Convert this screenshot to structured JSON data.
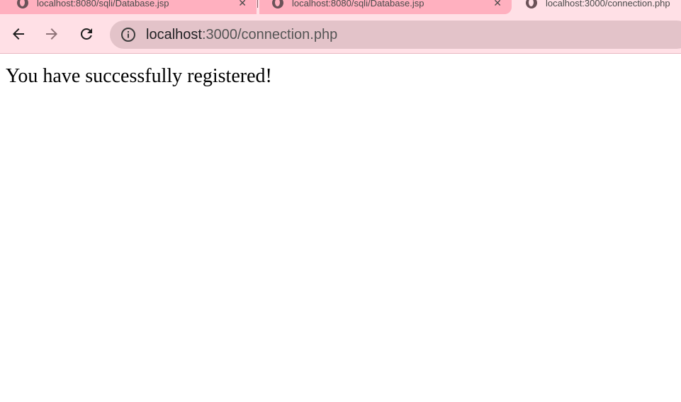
{
  "browser": {
    "tabs": [
      {
        "title": "localhost:8080/sqli/Database.jsp",
        "active": false,
        "close_glyph": "✕"
      },
      {
        "title": "localhost:8080/sqli/Database.jsp",
        "active": false,
        "close_glyph": "✕"
      },
      {
        "title": "localhost:3000/connection.php",
        "active": true
      }
    ],
    "address_bar": {
      "host": "localhost",
      "path": ":3000/connection.php"
    },
    "icons": {
      "back": "back-arrow-icon",
      "forward": "forward-arrow-icon",
      "reload": "reload-icon",
      "site_info": "info-icon",
      "tab_favicon": "globe-icon"
    },
    "colors": {
      "tab_strip": "#ffe0e6",
      "inactive_tab": "#ffb0bf",
      "omnibox": "#e3c3c9"
    }
  },
  "page": {
    "message": "You have successfully registered!"
  }
}
